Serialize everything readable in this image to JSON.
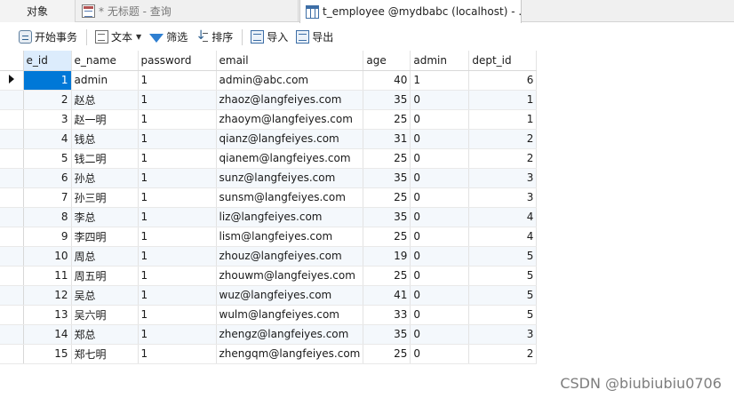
{
  "tabs": [
    {
      "label": "对象"
    },
    {
      "label": "* 无标题 - 查询"
    },
    {
      "label": "t_employee @mydbabc (localhost) - ..."
    }
  ],
  "toolbar": {
    "begin_label": "开始事务",
    "text_label": "文本",
    "filter_label": "筛选",
    "sort_label": "排序",
    "import_label": "导入",
    "export_label": "导出"
  },
  "grid": {
    "columns": [
      "e_id",
      "e_name",
      "password",
      "email",
      "age",
      "admin",
      "dept_id"
    ],
    "rows": [
      [
        "1",
        "admin",
        "1",
        "admin@abc.com",
        "40",
        "1",
        "6"
      ],
      [
        "2",
        "赵总",
        "1",
        "zhaoz@langfeiyes.com",
        "35",
        "0",
        "1"
      ],
      [
        "3",
        "赵一明",
        "1",
        "zhaoym@langfeiyes.com",
        "25",
        "0",
        "1"
      ],
      [
        "4",
        "钱总",
        "1",
        "qianz@langfeiyes.com",
        "31",
        "0",
        "2"
      ],
      [
        "5",
        "钱二明",
        "1",
        "qianem@langfeiyes.com",
        "25",
        "0",
        "2"
      ],
      [
        "6",
        "孙总",
        "1",
        "sunz@langfeiyes.com",
        "35",
        "0",
        "3"
      ],
      [
        "7",
        "孙三明",
        "1",
        "sunsm@langfeiyes.com",
        "25",
        "0",
        "3"
      ],
      [
        "8",
        "李总",
        "1",
        "liz@langfeiyes.com",
        "35",
        "0",
        "4"
      ],
      [
        "9",
        "李四明",
        "1",
        "lism@langfeiyes.com",
        "25",
        "0",
        "4"
      ],
      [
        "10",
        "周总",
        "1",
        "zhouz@langfeiyes.com",
        "19",
        "0",
        "5"
      ],
      [
        "11",
        "周五明",
        "1",
        "zhouwm@langfeiyes.com",
        "25",
        "0",
        "5"
      ],
      [
        "12",
        "吴总",
        "1",
        "wuz@langfeiyes.com",
        "41",
        "0",
        "5"
      ],
      [
        "13",
        "吴六明",
        "1",
        "wulm@langfeiyes.com",
        "33",
        "0",
        "5"
      ],
      [
        "14",
        "郑总",
        "1",
        "zhengz@langfeiyes.com",
        "35",
        "0",
        "3"
      ],
      [
        "15",
        "郑七明",
        "1",
        "zhengqm@langfeiyes.com",
        "25",
        "0",
        "2"
      ]
    ],
    "selected_row": 0,
    "selected_column": "e_id"
  },
  "watermark": "CSDN @biubiubiu0706",
  "colors": {
    "selection": "#0078d7",
    "selected_header": "#dcecfc",
    "alt_row": "#f4f8fc"
  }
}
